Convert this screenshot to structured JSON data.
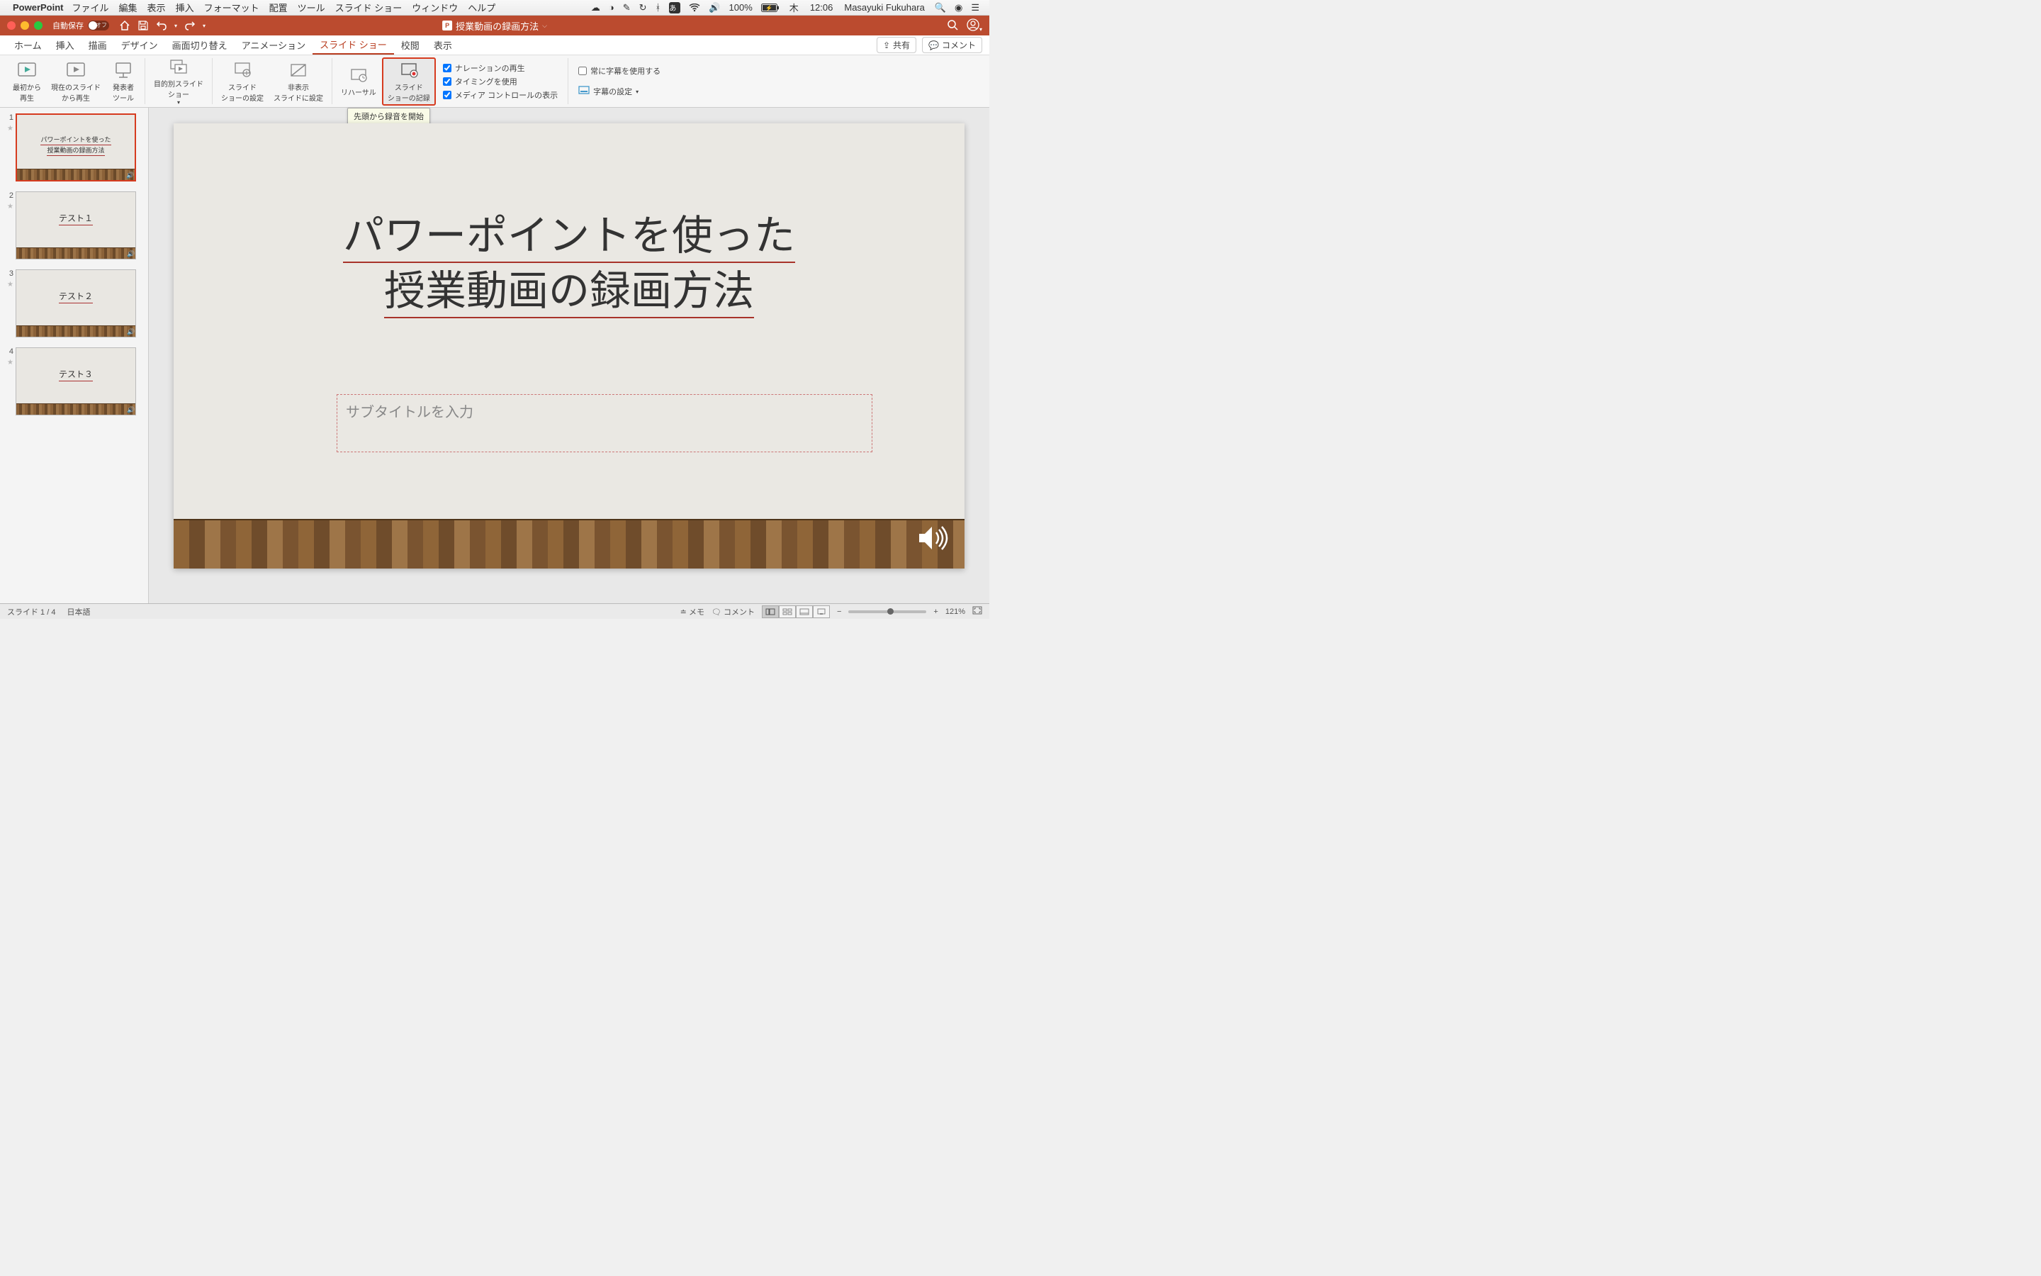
{
  "menubar": {
    "app": "PowerPoint",
    "items": [
      "ファイル",
      "編集",
      "表示",
      "挿入",
      "フォーマット",
      "配置",
      "ツール",
      "スライド ショー",
      "ウィンドウ",
      "ヘルプ"
    ],
    "battery": "100%",
    "day": "木",
    "time": "12:06",
    "user": "Masayuki Fukuhara"
  },
  "titlebar": {
    "autosave_label": "自動保存",
    "autosave_state": "オフ",
    "doc_title": "授業動画の録画方法"
  },
  "tabs": {
    "items": [
      "ホーム",
      "挿入",
      "描画",
      "デザイン",
      "画面切り替え",
      "アニメーション",
      "スライド ショー",
      "校閲",
      "表示"
    ],
    "active_index": 6,
    "share": "共有",
    "comments": "コメント"
  },
  "ribbon": {
    "from_start": "最初から\n再生",
    "from_current": "現在のスライド\nから再生",
    "presenter": "発表者\nツール",
    "custom": "目的別スライド\nショー",
    "setup": "スライド\nショーの設定",
    "hide": "非表示\nスライドに設定",
    "rehearse": "リハーサル",
    "record": "スライド\nショーの記録",
    "chk_narration": "ナレーションの再生",
    "chk_timing": "タイミングを使用",
    "chk_media": "メディア コントロールの表示",
    "chk_subtitle_always": "常に字幕を使用する",
    "subtitle_settings": "字幕の設定",
    "tooltip": "先頭から録音を開始"
  },
  "thumbs": [
    {
      "num": "1",
      "title1": "パワーポイントを使った",
      "title2": "授業動画の録画方法",
      "selected": true
    },
    {
      "num": "2",
      "title1": "テスト１",
      "title2": "",
      "selected": false
    },
    {
      "num": "3",
      "title1": "テスト２",
      "title2": "",
      "selected": false
    },
    {
      "num": "4",
      "title1": "テスト３",
      "title2": "",
      "selected": false
    }
  ],
  "slide": {
    "title_line1": "パワーポイントを使った",
    "title_line2": "授業動画の録画方法",
    "subtitle_placeholder": "サブタイトルを入力"
  },
  "statusbar": {
    "slide_count": "スライド 1 / 4",
    "language": "日本語",
    "notes": "メモ",
    "comments": "コメント",
    "zoom": "121%"
  }
}
